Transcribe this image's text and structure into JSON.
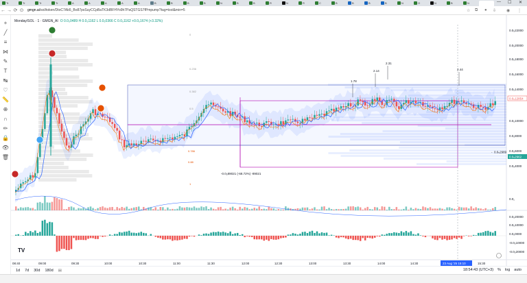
{
  "browser": {
    "tabs": [
      {
        "label": "Tr",
        "color": "#2e7d32"
      },
      {
        "label": "Tr",
        "color": "#2e7d32"
      },
      {
        "label": "Tr",
        "color": "#2e7d32"
      },
      {
        "label": "Tr",
        "color": "#2e7d32"
      },
      {
        "label": "A",
        "color": "#2e7d32"
      },
      {
        "label": "A",
        "color": "#2e7d32"
      },
      {
        "label": "A",
        "color": "#2e7d32"
      },
      {
        "label": "A",
        "color": "#2e7d32"
      },
      {
        "label": "A",
        "color": "#2e7d32"
      },
      {
        "label": "B",
        "color": "#607d8b"
      },
      {
        "label": "B",
        "color": "#2e7d32"
      },
      {
        "label": "B",
        "color": "#2e7d32"
      },
      {
        "label": "B",
        "color": "#2e7d32"
      },
      {
        "label": "N",
        "color": "#2e7d32"
      },
      {
        "label": "B",
        "color": "#2e7d32"
      },
      {
        "label": "B",
        "color": "#2e7d32"
      },
      {
        "label": "R",
        "color": "#2e7d32"
      },
      {
        "label": "N",
        "color": "#111111"
      },
      {
        "label": "R",
        "color": "#2e7d32"
      },
      {
        "label": "C",
        "color": "#2e7d32"
      },
      {
        "label": "B",
        "color": "#2e7d32"
      },
      {
        "label": "B",
        "color": "#1565c0"
      },
      {
        "label": "B",
        "color": "#1565c0"
      },
      {
        "label": "B",
        "color": "#1565c0"
      },
      {
        "label": "N",
        "color": "#2e7d32"
      },
      {
        "label": "O",
        "color": "#2e7d32"
      },
      {
        "label": "N",
        "color": "#111111"
      },
      {
        "label": "B",
        "color": "#2e7d32"
      },
      {
        "label": "N",
        "color": "#2e7d32"
      },
      {
        "label": "",
        "color": "#ffffff"
      }
    ],
    "url_host": "gmgn.ai",
    "url_path": "/sol/token/DtoC7Ab5_Bo87psSuyCCpBaTK3dBFHYo9h7PaQSTGS7fPmpump?tag=tool&min=5"
  },
  "legend": {
    "symbol": "Monday/SOL · 1 · GMGN_AI",
    "ohlc": "O 0.0₅0489 H 0.0₅1162 L 0.0₅0366 C 0.0₅1162 +0.0₅1674 (+3.32%)"
  },
  "price_axis": {
    "labels": [
      "0.0₅22000",
      "0.0₅20000",
      "0.0₅18000",
      "0.0₅16000",
      "0.0₅14000",
      "0.0₅10000",
      "0.0₅8000",
      "0.0₅6000",
      "0.0₅4000"
    ],
    "current_price": "0.0₅12854",
    "measure_price": "0.0₅2989",
    "lower_price": "0.0₅2962",
    "vol_label": "0.0₁"
  },
  "macd_axis": {
    "labels": [
      "0.0₅20000",
      "0.0₅10000",
      "0.0₅0000",
      "-0.0₅10000",
      "-0.0₅20000"
    ]
  },
  "time_axis": {
    "labels": [
      "08:40",
      "09:00",
      "09:30",
      "10:00",
      "10:30",
      "11:00",
      "11:30",
      "12:00",
      "12:30",
      "13:00",
      "13:30",
      "14:00",
      "14:30",
      "15:30"
    ],
    "crosshair_label": "23 Aug '25   15:10"
  },
  "annotations": {
    "measure": "-0.0₅89021 (-68.72%) -89021",
    "price_marks": [
      "1.78",
      "2.14",
      "2.31",
      "2.44"
    ],
    "fib_labels": [
      "0",
      "0.236",
      "0.382",
      "0.5",
      "0.618",
      "0.786",
      "0.88",
      "1"
    ]
  },
  "bottom_bar": {
    "ranges": [
      "1d",
      "7d",
      "30d",
      "180d"
    ],
    "time": "18:54:43 (UTC+3)",
    "pct": "%",
    "log": "log",
    "auto": "auto"
  },
  "logo_text": "TV",
  "colors": {
    "up": "#26a69a",
    "down": "#ef5350",
    "band": "#2962ff",
    "magenta": "#b000b0",
    "accent": "#2962ff"
  }
}
